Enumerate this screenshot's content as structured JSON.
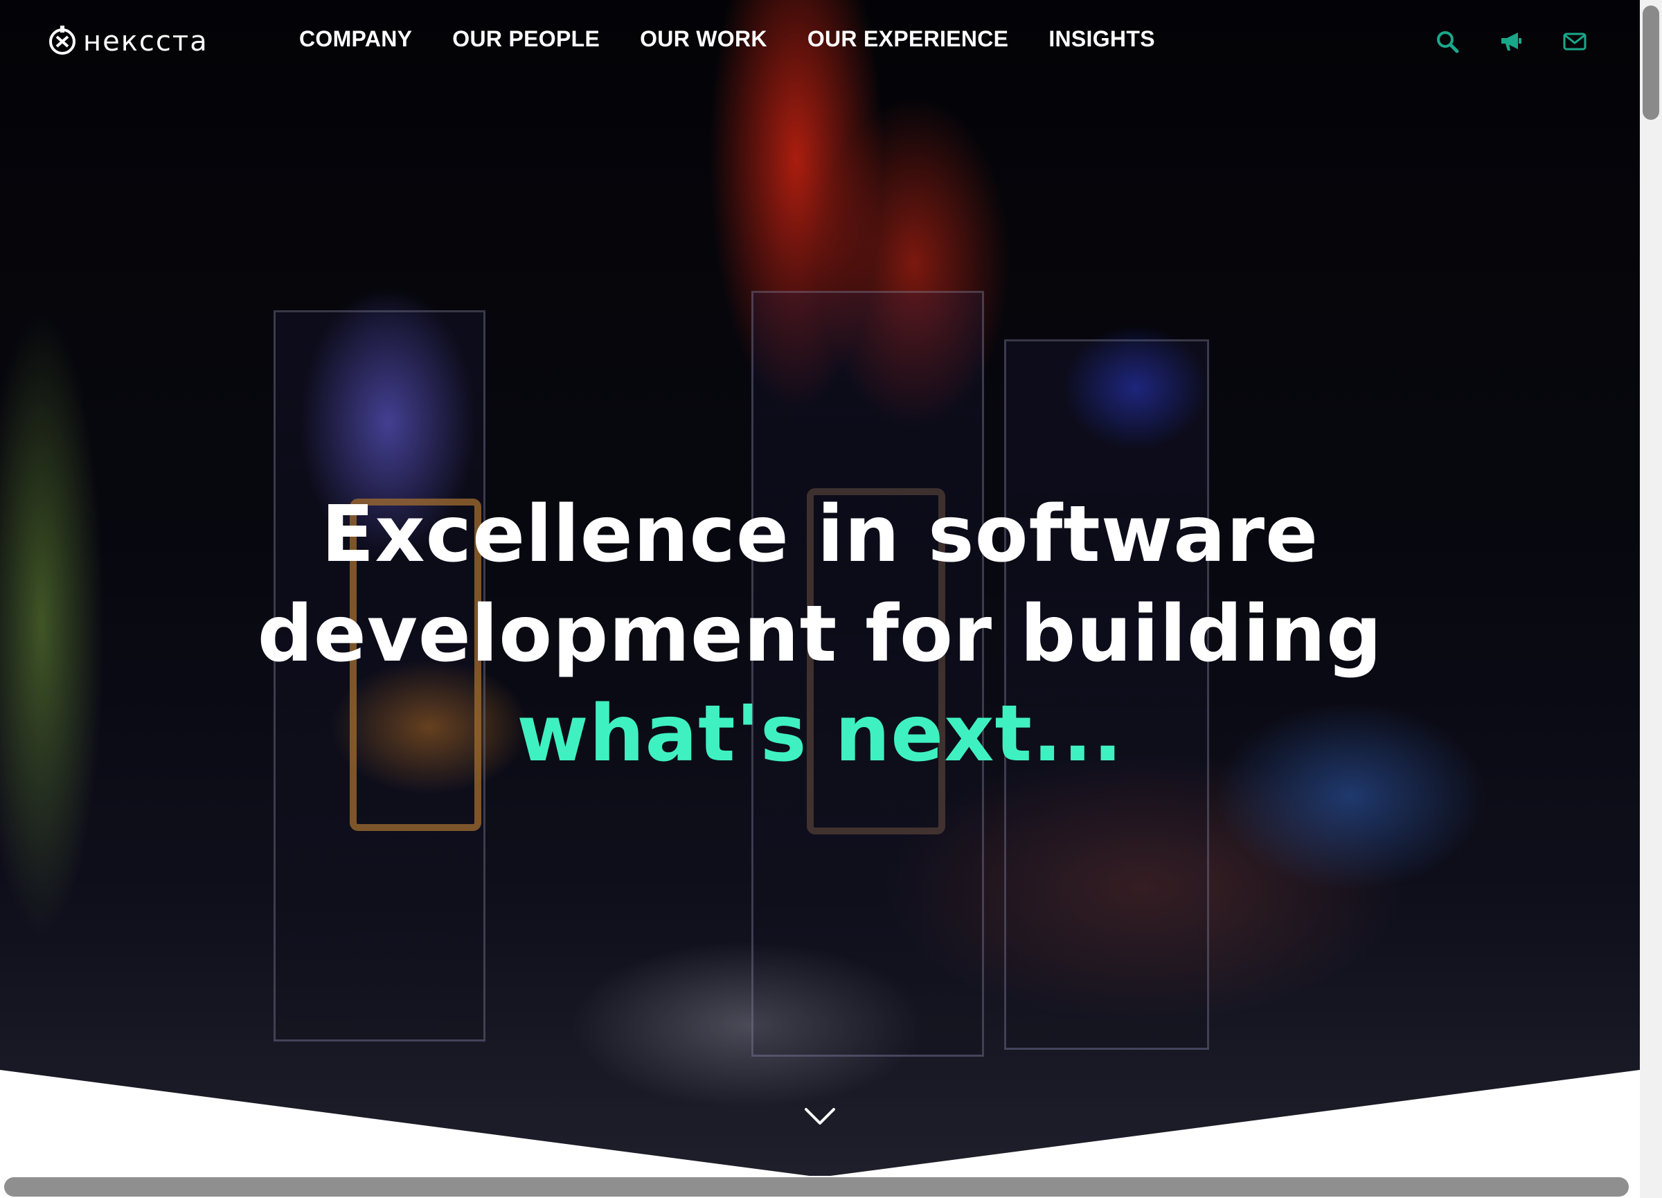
{
  "brand": {
    "logo_text": "нексста"
  },
  "nav": {
    "items": [
      {
        "label": "COMPANY"
      },
      {
        "label": "OUR PEOPLE"
      },
      {
        "label": "OUR WORK"
      },
      {
        "label": "OUR EXPERIENCE"
      },
      {
        "label": "INSIGHTS"
      }
    ]
  },
  "header_icons": [
    {
      "icon": "search-icon"
    },
    {
      "icon": "megaphone-icon"
    },
    {
      "icon": "envelope-icon"
    }
  ],
  "hero": {
    "line1": "Excellence in software",
    "line2": "development for building",
    "accent": "what's next..."
  },
  "colors": {
    "accent": "#3ff1c0",
    "icon_teal": "#1aa88a",
    "text": "#ffffff"
  },
  "scroll_icon": "chevron-down-icon"
}
